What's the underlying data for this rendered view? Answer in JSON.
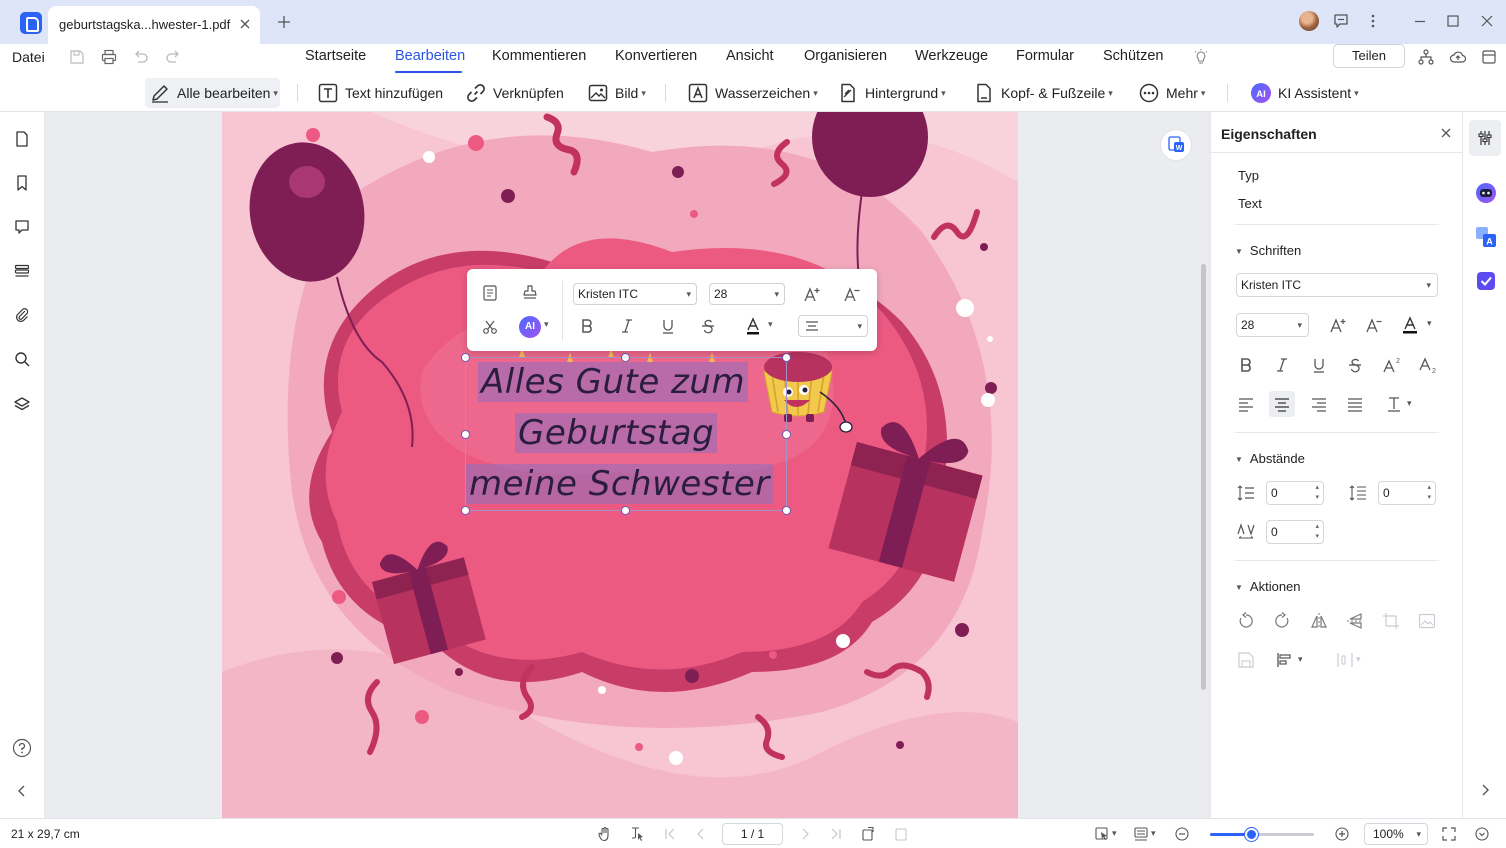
{
  "titlebar": {
    "tab_title": "geburtstagska...hwester-1.pdf"
  },
  "menu": {
    "file_label": "Datei",
    "tabs": [
      {
        "label": "Startseite",
        "active": false
      },
      {
        "label": "Bearbeiten",
        "active": true
      },
      {
        "label": "Kommentieren",
        "active": false
      },
      {
        "label": "Konvertieren",
        "active": false
      },
      {
        "label": "Ansicht",
        "active": false
      },
      {
        "label": "Organisieren",
        "active": false
      },
      {
        "label": "Werkzeuge",
        "active": false
      },
      {
        "label": "Formular",
        "active": false
      },
      {
        "label": "Schützen",
        "active": false
      }
    ],
    "share_label": "Teilen",
    "accent_color": "#2a55e5"
  },
  "toolbar": {
    "all_edit": "Alle bearbeiten",
    "add_text": "Text hinzufügen",
    "link": "Verknüpfen",
    "image": "Bild",
    "watermark": "Wasserzeichen",
    "background": "Hintergrund",
    "header_footer": "Kopf- & Fußzeile",
    "more": "Mehr",
    "ai_assistant": "KI Assistent"
  },
  "float_toolbar": {
    "font": "Kristen ITC",
    "size": "28",
    "ai_badge": "AI"
  },
  "document": {
    "greeting_lines": [
      "Alles Gute zum",
      "Geburtstag",
      "meine Schwester"
    ]
  },
  "properties": {
    "title": "Eigenschaften",
    "type_label": "Typ",
    "type_value": "Text",
    "fonts_section": "Schriften",
    "font": "Kristen ITC",
    "size": "28",
    "spacing_section": "Abstände",
    "line_spacing": "0",
    "paragraph_spacing": "0",
    "char_spacing": "0",
    "actions_section": "Aktionen"
  },
  "status": {
    "page_size": "21 x 29,7 cm",
    "page_indicator": "1 / 1",
    "zoom": "100%",
    "zoom_fraction": 0.4
  }
}
